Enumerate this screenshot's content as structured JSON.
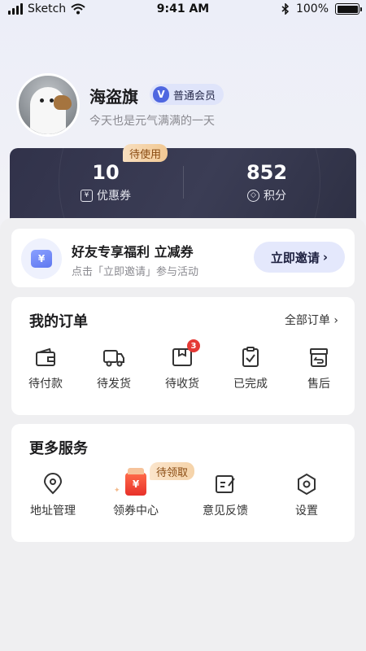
{
  "status_bar": {
    "carrier": "Sketch",
    "time": "9:41 AM",
    "battery": "100%",
    "icons": [
      "signal-icon",
      "wifi-icon",
      "bluetooth-icon",
      "battery-icon"
    ]
  },
  "profile": {
    "name": "海盗旗",
    "member_badge": "普通会员",
    "member_badge_icon": "V",
    "tagline": "今天也是元气满满的一天"
  },
  "stats": {
    "pending_tag": "待使用",
    "coupons": {
      "value": "10",
      "label": "优惠券",
      "icon": "coupon-icon"
    },
    "points": {
      "value": "852",
      "label": "积分",
      "icon": "points-icon"
    }
  },
  "invite": {
    "title": "好友专享福利 立减券",
    "subtitle": "点击「立即邀请」参与活动",
    "button": "立即邀请",
    "button_arrow": "›",
    "icon_symbol": "¥"
  },
  "orders": {
    "title": "我的订单",
    "all_link": "全部订单 ›",
    "items": [
      {
        "label": "待付款",
        "icon": "wallet-icon"
      },
      {
        "label": "待发货",
        "icon": "truck-icon"
      },
      {
        "label": "待收货",
        "icon": "box-icon",
        "badge": "3"
      },
      {
        "label": "已完成",
        "icon": "clipboard-check-icon"
      },
      {
        "label": "售后",
        "icon": "return-box-icon"
      }
    ]
  },
  "services": {
    "title": "更多服务",
    "claim_tag": "待领取",
    "items": [
      {
        "label": "地址管理",
        "icon": "location-pin-icon"
      },
      {
        "label": "领券中心",
        "icon": "coupon-center-icon",
        "symbol": "¥"
      },
      {
        "label": "意见反馈",
        "icon": "feedback-icon"
      },
      {
        "label": "设置",
        "icon": "settings-icon"
      }
    ]
  },
  "colors": {
    "accent_blue": "#4f67e0",
    "stats_card_bg": "#31324a",
    "tag_gold": "#f1c893",
    "badge_red": "#e53935",
    "page_bg": "#efeff1"
  }
}
